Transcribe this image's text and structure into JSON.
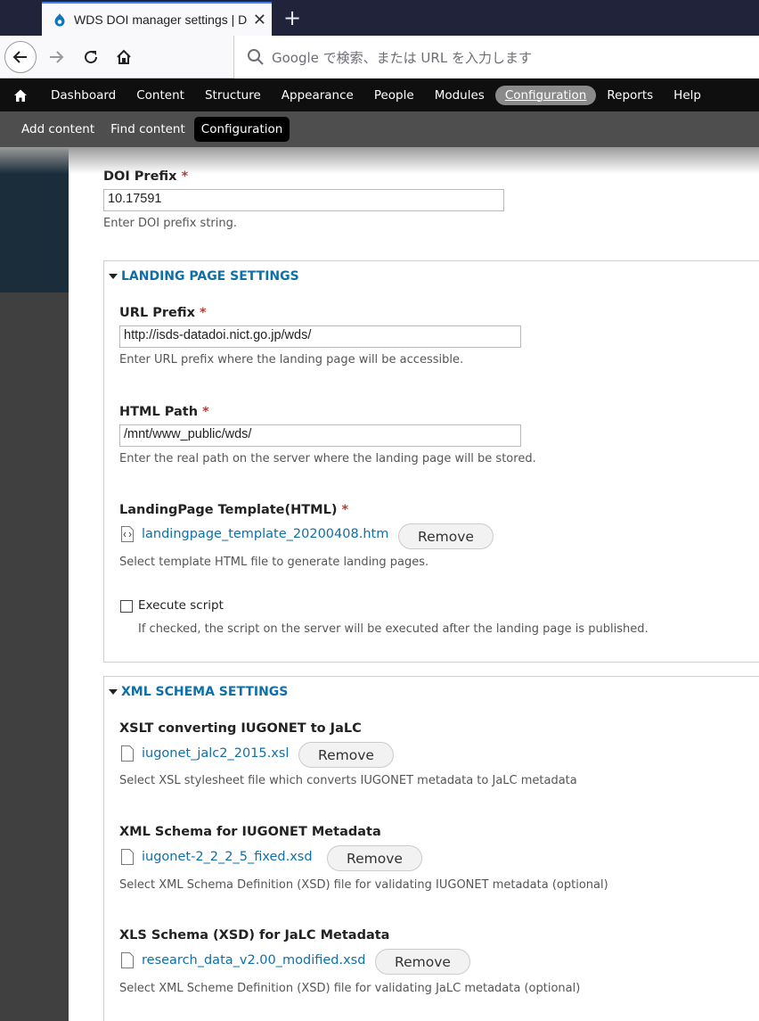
{
  "browser": {
    "tab_title": "WDS DOI manager settings | D",
    "url_placeholder": "Google で検索、または URL を入力します"
  },
  "toolbar": {
    "items": [
      "Dashboard",
      "Content",
      "Structure",
      "Appearance",
      "People",
      "Modules",
      "Configuration",
      "Reports",
      "Help"
    ],
    "active": "Configuration"
  },
  "shortcuts": {
    "items": [
      "Add content",
      "Find content",
      "Configuration"
    ]
  },
  "doi_prefix": {
    "label": "DOI Prefix",
    "required": "*",
    "value": "10.17591",
    "description": "Enter DOI prefix string."
  },
  "landing_page": {
    "legend": "LANDING PAGE SETTINGS",
    "url_prefix": {
      "label": "URL Prefix",
      "required": "*",
      "value": "http://isds-datadoi.nict.go.jp/wds/",
      "description": "Enter URL prefix where the landing page will be accessible."
    },
    "html_path": {
      "label": "HTML Path",
      "required": "*",
      "value": "/mnt/www_public/wds/",
      "description": "Enter the real path on the server where the landing page will be stored."
    },
    "template": {
      "label": "LandingPage Template(HTML)",
      "required": "*",
      "file": "landingpage_template_20200408.htm",
      "remove": "Remove",
      "description": "Select template HTML file to generate landing pages."
    },
    "execute_script": {
      "label": "Execute script",
      "description": "If checked, the script on the server will be executed after the landing page is published."
    }
  },
  "xml_schema": {
    "legend": "XML SCHEMA SETTINGS",
    "xslt": {
      "label": "XSLT converting IUGONET to JaLC",
      "file": "iugonet_jalc2_2015.xsl",
      "remove": "Remove",
      "description": "Select XSL stylesheet file which converts IUGONET metadata to JaLC metadata"
    },
    "iugonet_schema": {
      "label": "XML Schema for IUGONET Metadata",
      "file": "iugonet-2_2_2_5_fixed.xsd",
      "remove": "Remove",
      "description": "Select XML Schema Definition (XSD) file for validating IUGONET metadata (optional)"
    },
    "jalc_schema": {
      "label": "XLS Schema (XSD) for JaLC Metadata",
      "file": "research_data_v2.00_modified.xsd",
      "remove": "Remove",
      "description": "Select XML Scheme Definition (XSD) file for validating JaLC metadata (optional)"
    }
  }
}
